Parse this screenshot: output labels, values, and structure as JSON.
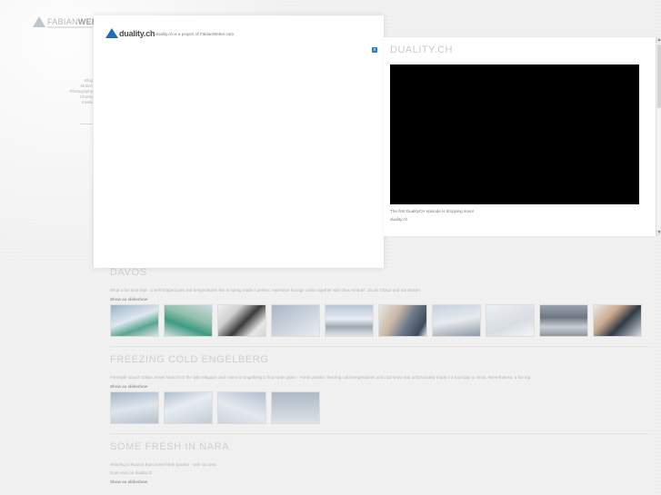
{
  "site": {
    "logo_light": "FABIAN",
    "logo_bold": "WEBER",
    "nav": [
      "Blog",
      "Motion",
      "Photography",
      "Charity",
      "Inside"
    ]
  },
  "overlay": {
    "logo_text": "duality.ch",
    "tagline": "duality.ch is a project of FabianWeber.com",
    "close_label": "x"
  },
  "panel": {
    "title": "DUALITY.CH",
    "caption": "The first DualityCH episode is dropping soon!",
    "link": "duality.ch"
  },
  "sections": [
    {
      "title": "DAVOS",
      "description": "What a fun time that - a well shaped park and temperatures like in spring made it perfect. Awesome footage came together with Elias Ambühl, Jacob Giraud and Kai Mahler.",
      "slideshow": "Show as slideshow"
    },
    {
      "title": "FREEZING COLD ENGELBERG",
      "description": "Freestyle Gauch Gillian, Kevin Nuss from the 18to Magazin and I went to Engelberg to find some pipes - Fresh powder, freezing cold temperatures and cold snow that unfortunately made it a hard day to shoot. Nevertheless, a fun trip.",
      "slideshow": "Show as slideshow"
    },
    {
      "title": "SOME FRESH IN NARA",
      "description": "Heading to Nara to hunt some fresh powder - with success.",
      "link": "Dont miss on duality.ch",
      "slideshow": "Show as slideshow"
    }
  ],
  "scrollbar": {
    "up": "▲",
    "down": "▼"
  }
}
